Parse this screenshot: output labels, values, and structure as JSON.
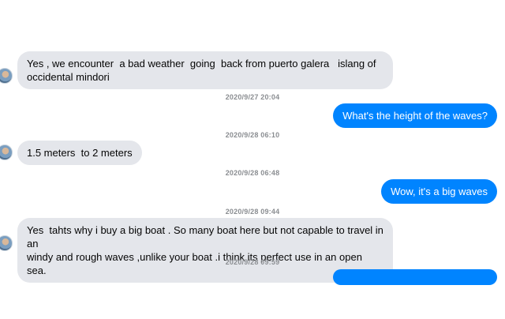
{
  "messages": [
    {
      "text": "Yes , we encounter  a bad weather  going  back from puerto galera   islang of\noccidental mindori"
    },
    {
      "text": "What's the height of the waves?"
    },
    {
      "text": "1.5 meters  to 2 meters"
    },
    {
      "text": "Wow, it's a big waves"
    },
    {
      "text": "Yes  tahts why i buy a big boat . So many boat here but not capable to travel in an\nwindy and rough waves ,unlike your boat .i think its perfect use in an open sea."
    }
  ],
  "timestamps": [
    "2020/9/27 20:04",
    "2020/9/28 06:10",
    "2020/9/28 06:48",
    "2020/9/28 09:44",
    "2020/9/28 09:59"
  ],
  "colors": {
    "outgoing_bubble": "#0084ff",
    "incoming_bubble": "#e4e6eb",
    "timestamp_text": "#8a8d91"
  },
  "icons": {
    "avatar": "user-avatar"
  }
}
